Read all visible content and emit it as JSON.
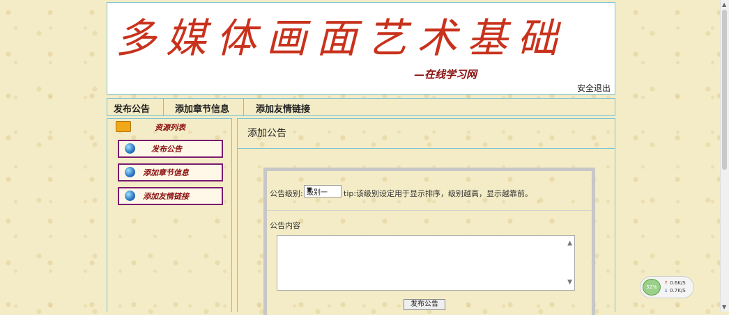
{
  "header": {
    "title": "多媒体画面艺术基础",
    "subtitle": "—在线学习网",
    "logout": "安全退出"
  },
  "nav": {
    "items": [
      "发布公告",
      "添加章节信息",
      "添加友情链接"
    ]
  },
  "sidebar": {
    "title": "资源列表",
    "items": [
      "发布公告",
      "添加章节信息",
      "添加友情链接"
    ]
  },
  "main": {
    "title": "添加公告",
    "form": {
      "level_label": "公告级别:",
      "level_value": "级别一",
      "level_hint": "tip:该级别设定用于显示排序，级别越高，显示越靠前。",
      "content_label": "公告内容",
      "submit_label": "发布公告"
    }
  },
  "net_speed": {
    "percent": "52%",
    "upload": "0.6K/S",
    "download": "0.7K/S"
  }
}
